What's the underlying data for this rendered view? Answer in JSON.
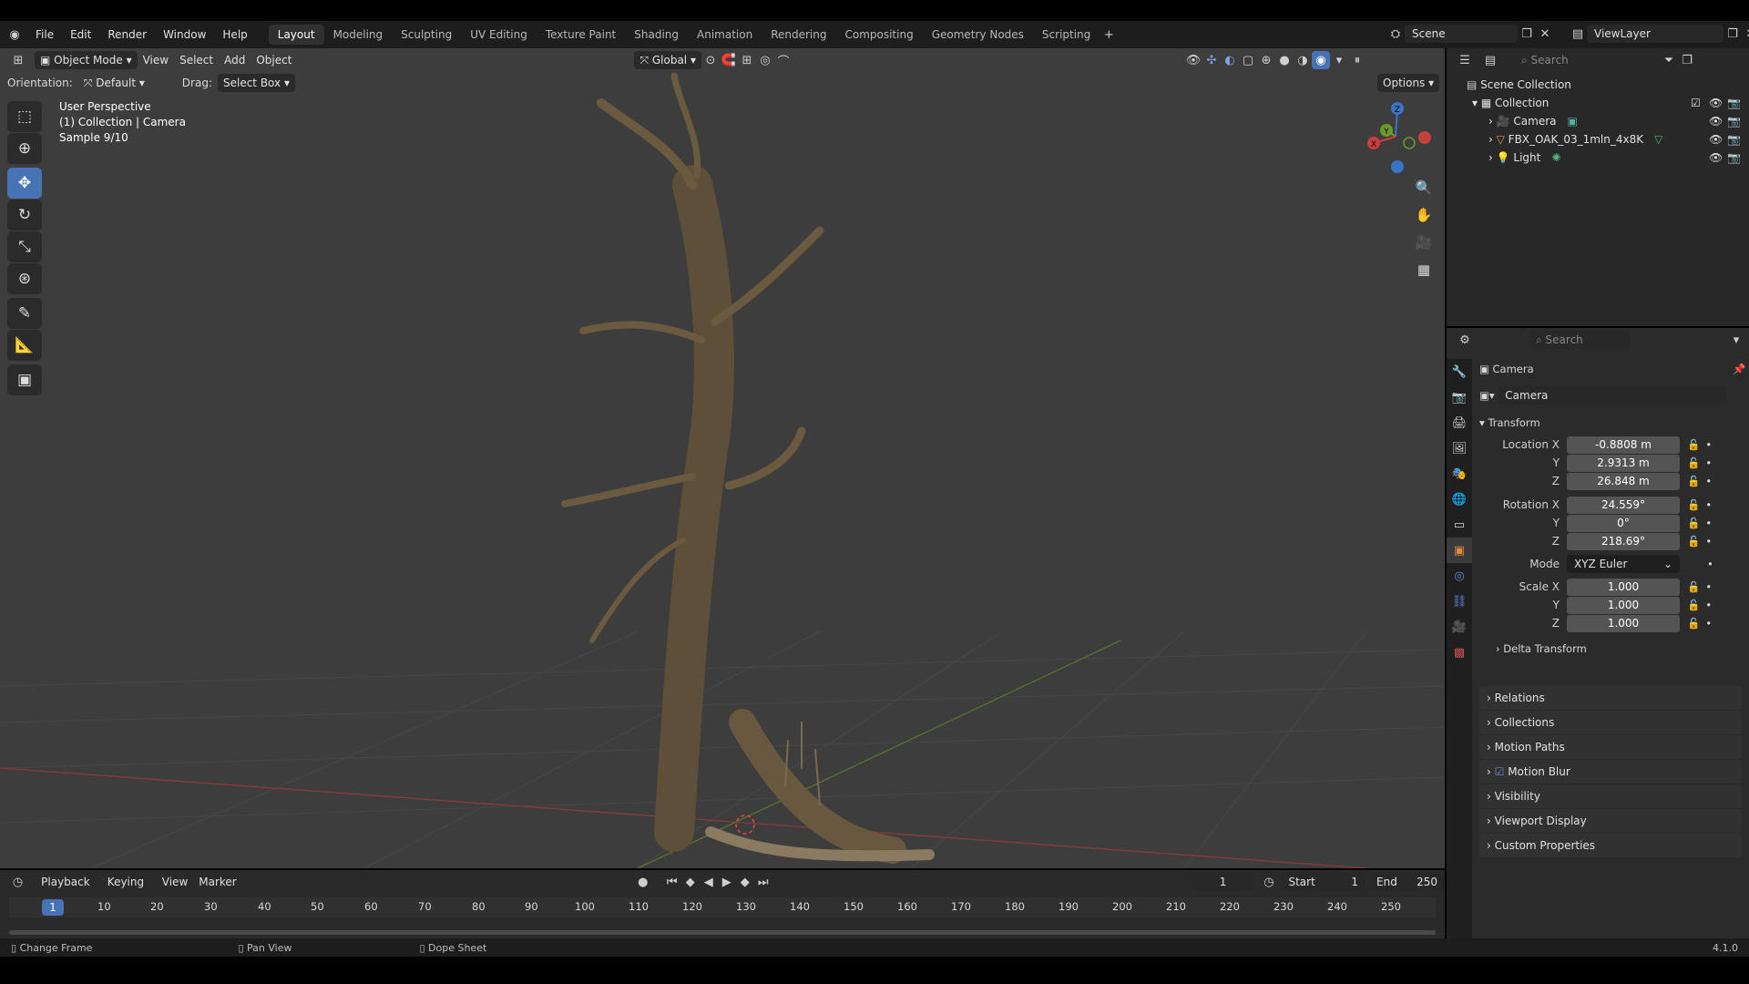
{
  "menu": {
    "items": [
      "File",
      "Edit",
      "Render",
      "Window",
      "Help"
    ]
  },
  "workspaces": [
    "Layout",
    "Modeling",
    "Sculpting",
    "UV Editing",
    "Texture Paint",
    "Shading",
    "Animation",
    "Rendering",
    "Compositing",
    "Geometry Nodes",
    "Scripting"
  ],
  "scene": {
    "name": "Scene",
    "view_layer": "ViewLayer"
  },
  "viewport_header": {
    "mode": "Object Mode",
    "menus": [
      "View",
      "Select",
      "Add",
      "Object"
    ],
    "transform_orientation": "Global",
    "orientation_label": "Orientation:",
    "orientation_value": "Default",
    "drag_label": "Drag:",
    "drag_value": "Select Box",
    "options": "Options"
  },
  "viewport_overlay": {
    "line1": "User Perspective",
    "line2": "(1) Collection | Camera",
    "line3": "Sample 9/10"
  },
  "gizmo": {
    "z": "Z",
    "y": "Y",
    "x": "X"
  },
  "outliner": {
    "search_placeholder": "Search",
    "root": "Scene Collection",
    "collection": "Collection",
    "objects": [
      "Camera",
      "FBX_OAK_03_1mln_4x8K",
      "Light"
    ]
  },
  "properties": {
    "search_placeholder": "Search",
    "object_name": "Camera",
    "datablock_name": "Camera",
    "transform_label": "Transform",
    "location_label": "Location X",
    "location": [
      "-0.8808 m",
      "2.9313 m",
      "26.848 m"
    ],
    "rotation_label": "Rotation X",
    "rotation": [
      "24.559°",
      "0°",
      "218.69°"
    ],
    "mode_label": "Mode",
    "mode_value": "XYZ Euler",
    "scale_label": "Scale X",
    "scale": [
      "1.000",
      "1.000",
      "1.000"
    ],
    "y_label": "Y",
    "z_label": "Z",
    "delta_transform": "Delta Transform",
    "panels": [
      "Relations",
      "Collections",
      "Motion Paths",
      "Motion Blur",
      "Visibility",
      "Viewport Display",
      "Custom Properties"
    ]
  },
  "timeline": {
    "menus": [
      "Playback",
      "Keying",
      "View",
      "Marker"
    ],
    "current_frame": "1",
    "start_label": "Start",
    "start": "1",
    "end_label": "End",
    "end": "250",
    "ticks": [
      "1",
      "10",
      "20",
      "30",
      "40",
      "50",
      "60",
      "70",
      "80",
      "90",
      "100",
      "110",
      "120",
      "130",
      "140",
      "150",
      "160",
      "170",
      "180",
      "190",
      "200",
      "210",
      "220",
      "230",
      "240",
      "250"
    ]
  },
  "statusbar": {
    "hint1": "Change Frame",
    "hint2": "Pan View",
    "hint3": "Dope Sheet",
    "version": "4.1.0"
  },
  "colors": {
    "accent": "#4772b3",
    "x_axis": "#c8403c",
    "y_axis": "#6a9a2a",
    "z_axis": "#3b73c7"
  }
}
